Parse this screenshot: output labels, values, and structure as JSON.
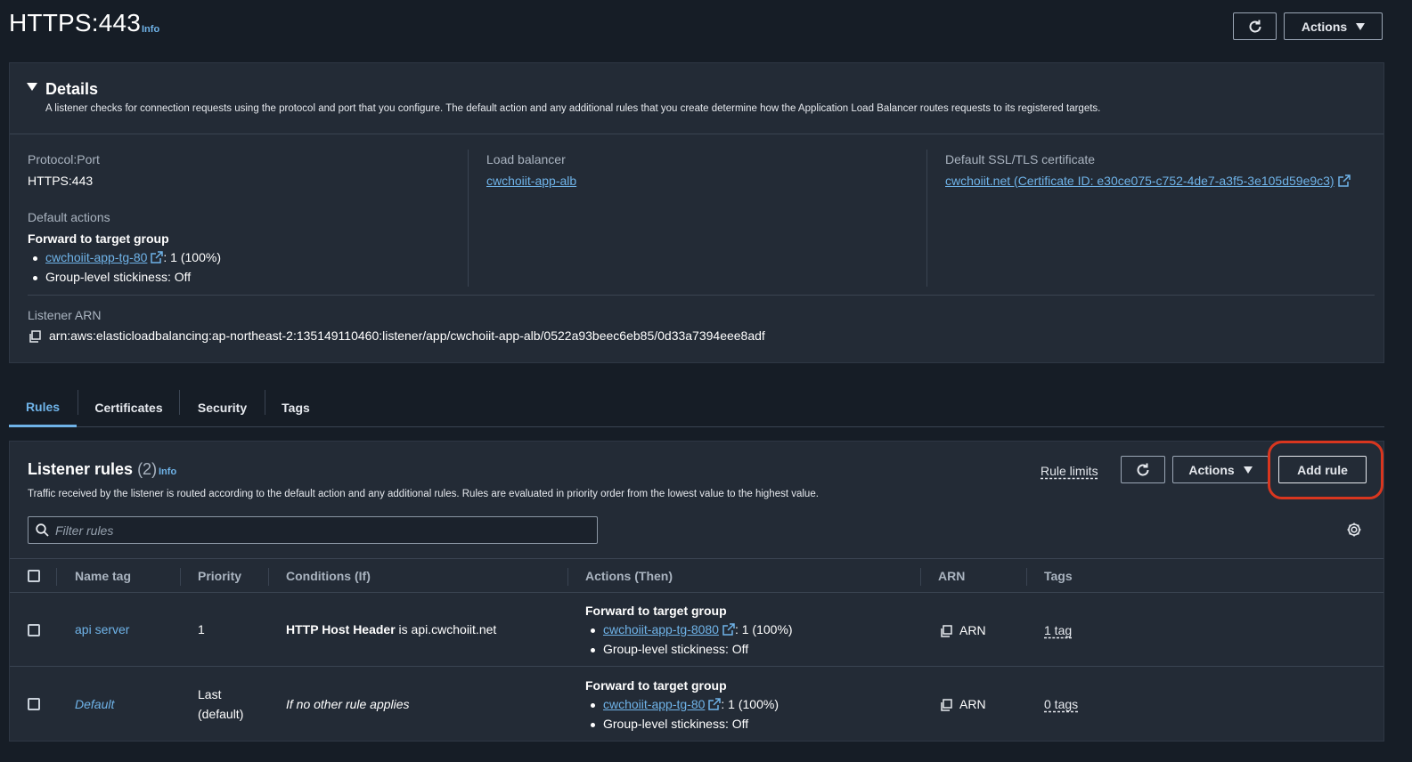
{
  "header": {
    "title": "HTTPS:443",
    "info": "Info",
    "actions_label": "Actions"
  },
  "details": {
    "title": "Details",
    "description": "A listener checks for connection requests using the protocol and port that you configure. The default action and any additional rules that you create determine how the Application Load Balancer routes requests to its registered targets.",
    "protocol_port_label": "Protocol:Port",
    "protocol_port_value": "HTTPS:443",
    "default_actions_label": "Default actions",
    "forward_label": "Forward to target group",
    "target_group_link": "cwchoiit-app-tg-80",
    "target_group_weight": ": 1 (100%)",
    "stickiness": "Group-level stickiness: Off",
    "load_balancer_label": "Load balancer",
    "load_balancer_link": "cwchoiit-app-alb",
    "certificate_label": "Default SSL/TLS certificate",
    "certificate_link": "cwchoiit.net (Certificate ID: e30ce075-c752-4de7-a3f5-3e105d59e9c3)",
    "arn_label": "Listener ARN",
    "arn_value": "arn:aws:elasticloadbalancing:ap-northeast-2:135149110460:listener/app/cwchoiit-app-alb/0522a93beec6eb85/0d33a7394eee8adf"
  },
  "tabs": [
    "Rules",
    "Certificates",
    "Security",
    "Tags"
  ],
  "rules": {
    "title": "Listener rules",
    "count": "(2)",
    "info": "Info",
    "description": "Traffic received by the listener is routed according to the default action and any additional rules. Rules are evaluated in priority order from the lowest value to the highest value.",
    "rule_limits": "Rule limits",
    "actions_label": "Actions",
    "add_rule_label": "Add rule",
    "filter_placeholder": "Filter rules",
    "columns": [
      "Name tag",
      "Priority",
      "Conditions (If)",
      "Actions (Then)",
      "ARN",
      "Tags"
    ],
    "rows": [
      {
        "name": "api server",
        "priority": "1",
        "priority_sub": "",
        "condition_bold": "HTTP Host Header",
        "condition_rest": " is api.cwchoiit.net",
        "action_title": "Forward to target group",
        "action_link": "cwchoiit-app-tg-8080",
        "action_weight": ": 1 (100%)",
        "action_stickiness": "Group-level stickiness: Off",
        "arn": "ARN",
        "tags": "1 tag"
      },
      {
        "name": "Default",
        "priority": "Last",
        "priority_sub": "(default)",
        "condition_bold": "",
        "condition_rest": "If no other rule applies",
        "action_title": "Forward to target group",
        "action_link": "cwchoiit-app-tg-80",
        "action_weight": ": 1 (100%)",
        "action_stickiness": "Group-level stickiness: Off",
        "arn": "ARN",
        "tags": "0 tags"
      }
    ]
  },
  "colors": {
    "background": "#161d26",
    "panel": "#232b36",
    "link": "#6fb3e8",
    "highlight": "#d9361f"
  }
}
